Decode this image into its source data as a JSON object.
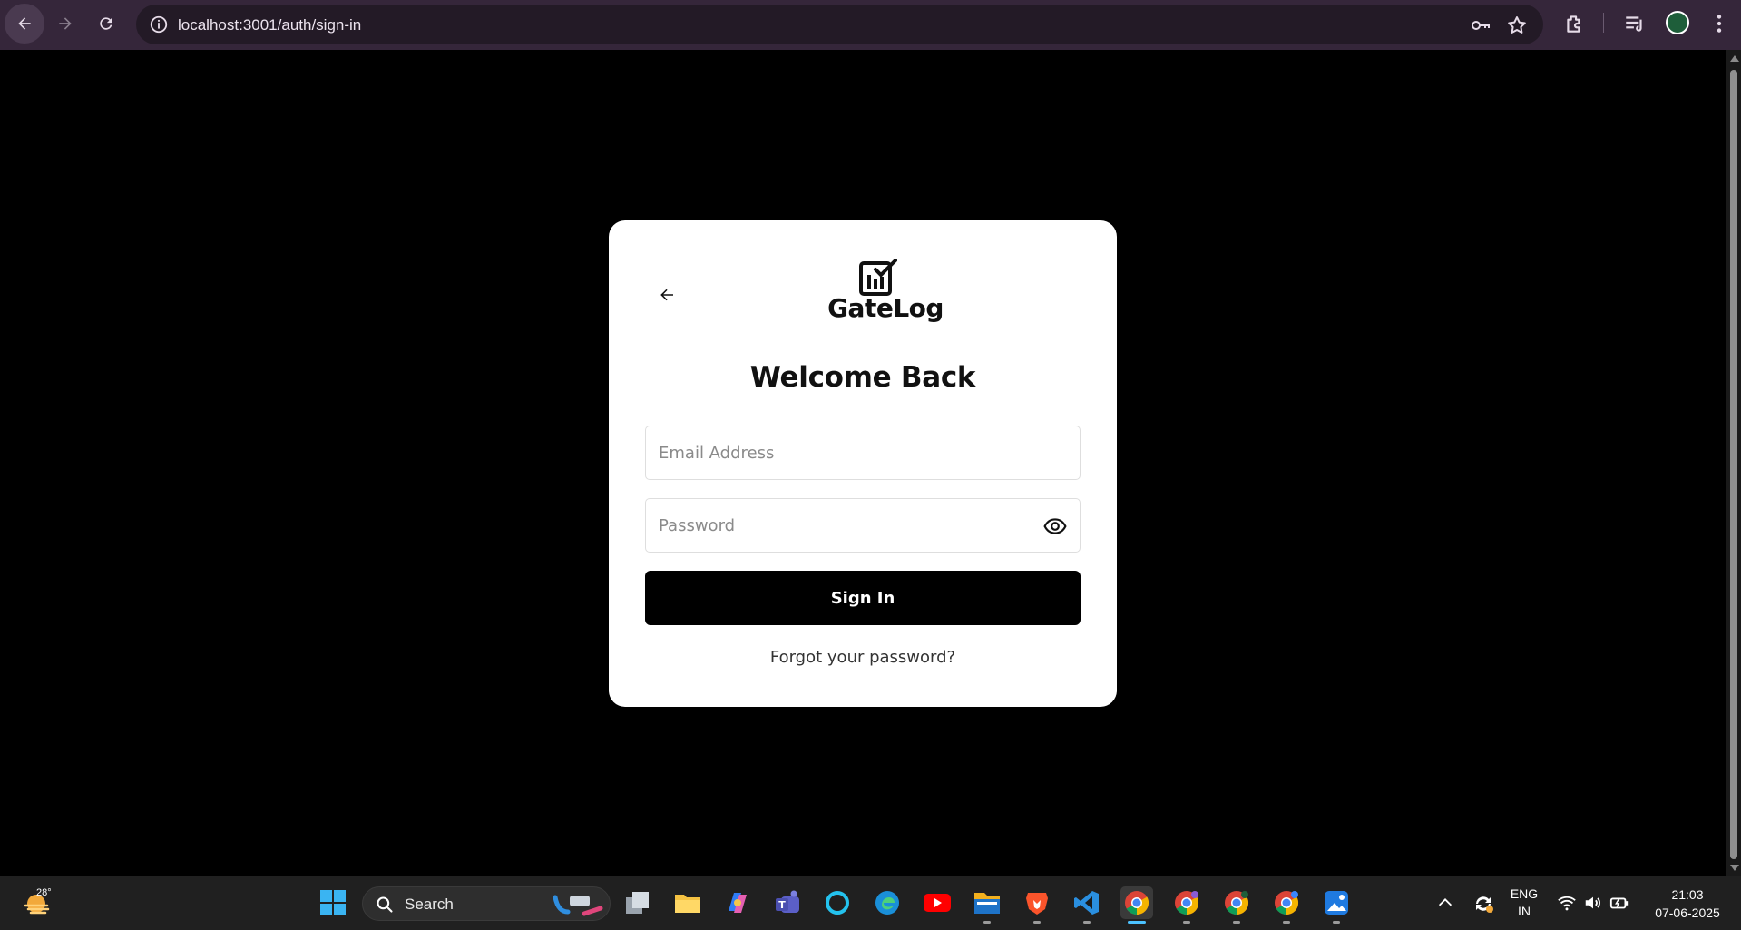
{
  "browser": {
    "url": "localhost:3001/auth/sign-in",
    "icons": [
      "back-icon",
      "forward-icon",
      "reload-icon",
      "site-info-icon",
      "password-key-icon",
      "bookmark-star-icon",
      "extensions-icon",
      "media-controls-icon",
      "profile-avatar",
      "menu-kebab-icon"
    ]
  },
  "signin": {
    "brand": "GateLog",
    "title": "Welcome Back",
    "email_placeholder": "Email Address",
    "email_value": "",
    "password_placeholder": "Password",
    "password_value": "",
    "submit_label": "Sign In",
    "forgot_link": "Forgot your password?"
  },
  "taskbar": {
    "weather_temp": "28°",
    "search_label": "Search",
    "apps": [
      "start",
      "task-view",
      "file-explorer",
      "copilot",
      "teams",
      "cortana",
      "edge",
      "youtube",
      "files",
      "brave",
      "vscode",
      "chrome",
      "chrome-profile-2",
      "chrome-profile-3",
      "chrome-profile-4",
      "photos"
    ],
    "language": "ENG",
    "region": "IN",
    "time": "21:03",
    "date": "07-06-2025"
  },
  "colors": {
    "browser_bar": "#35263a",
    "page_bg": "#000000",
    "card_bg": "#ffffff",
    "button_bg": "#000000",
    "taskbar_bg": "#202020"
  }
}
